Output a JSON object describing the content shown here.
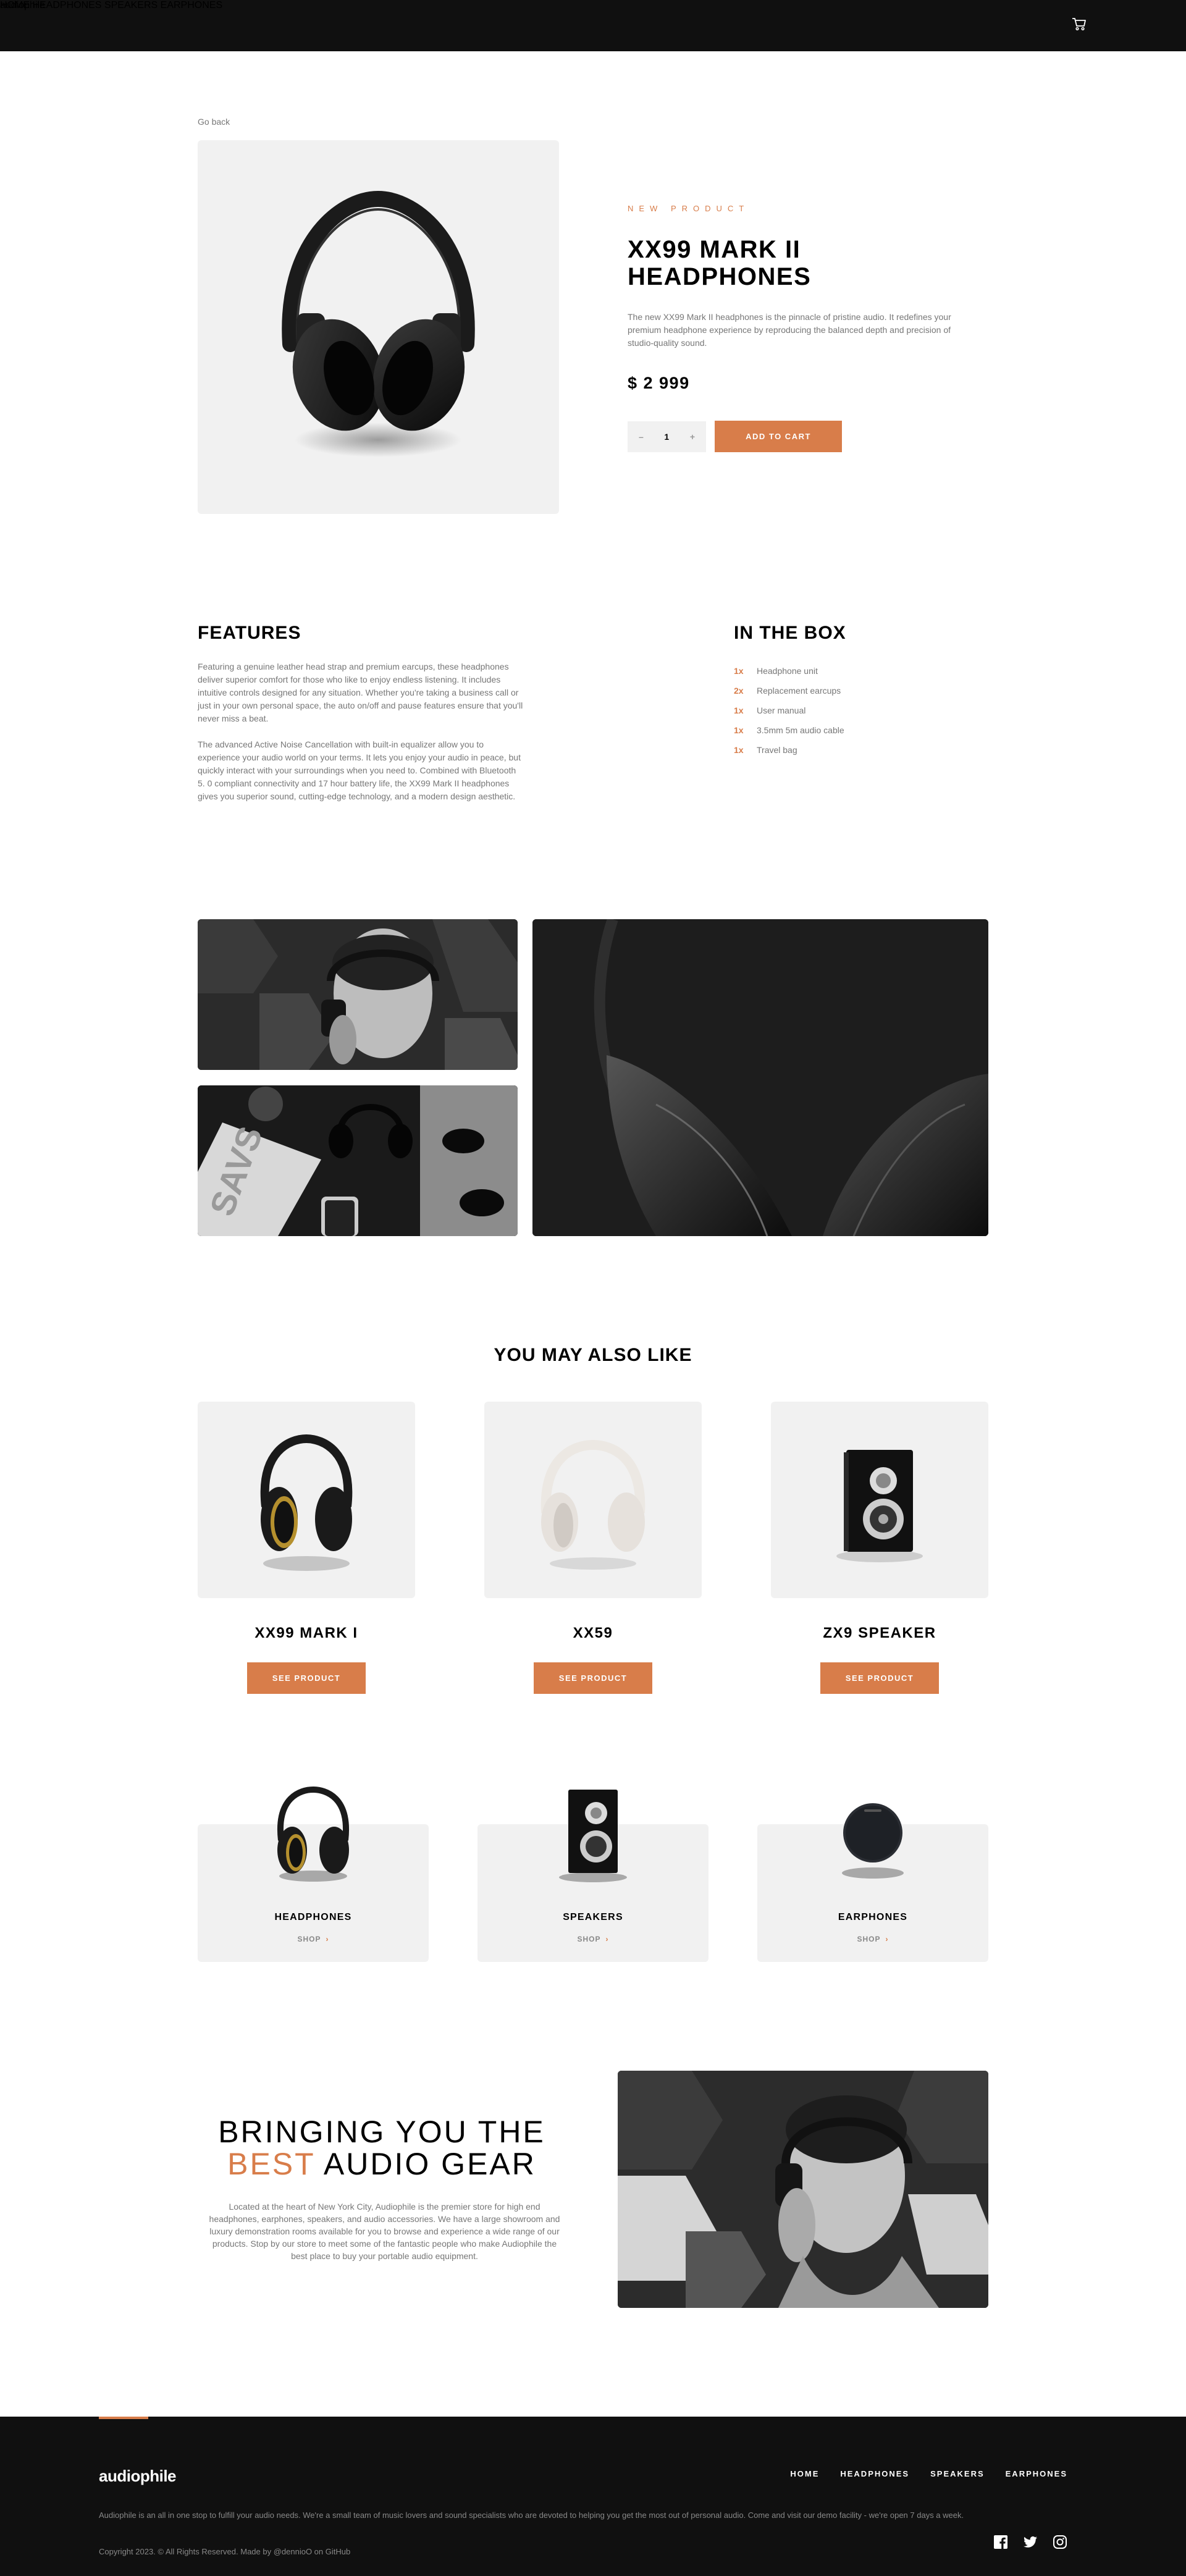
{
  "header": {
    "logo": "audiophile",
    "nav": [
      "HOME",
      "HEADPHONES",
      "SPEAKERS",
      "EARPHONES"
    ]
  },
  "product": {
    "go_back": "Go back",
    "eyebrow": "NEW PRODUCT",
    "title": "XX99 MARK II HEADPHONES",
    "description": "The new XX99 Mark II headphones is the pinnacle of pristine audio. It redefines your premium headphone experience by reproducing the balanced depth and precision of studio-quality sound.",
    "price": "$ 2 999",
    "quantity": "1",
    "minus": "–",
    "plus": "+",
    "add_to_cart": "ADD TO CART"
  },
  "features": {
    "title": "FEATURES",
    "paragraphs": [
      "Featuring a genuine leather head strap and premium earcups, these headphones deliver superior comfort for those who like to enjoy endless listening. It includes intuitive controls designed for any situation. Whether you're taking a business call or just in your own personal space, the auto on/off and pause features ensure that you'll never miss a beat.",
      "The advanced Active Noise Cancellation with built-in equalizer allow you to experience your audio world on your terms. It lets you enjoy your audio in peace, but quickly interact with your surroundings when you need to. Combined with Bluetooth 5. 0 compliant connectivity and 17 hour battery life, the XX99 Mark II headphones gives you superior sound, cutting-edge technology, and a modern design aesthetic."
    ]
  },
  "in_the_box": {
    "title": "IN THE BOX",
    "items": [
      {
        "qty": "1x",
        "name": "Headphone unit"
      },
      {
        "qty": "2x",
        "name": "Replacement earcups"
      },
      {
        "qty": "1x",
        "name": "User manual"
      },
      {
        "qty": "1x",
        "name": "3.5mm 5m audio cable"
      },
      {
        "qty": "1x",
        "name": "Travel bag"
      }
    ]
  },
  "you_may_also_like": {
    "title": "YOU MAY ALSO LIKE",
    "items": [
      {
        "name": "XX99 MARK I",
        "button": "SEE PRODUCT"
      },
      {
        "name": "XX59",
        "button": "SEE PRODUCT"
      },
      {
        "name": "ZX9 SPEAKER",
        "button": "SEE PRODUCT"
      }
    ]
  },
  "categories": [
    {
      "name": "HEADPHONES",
      "shop": "SHOP"
    },
    {
      "name": "SPEAKERS",
      "shop": "SHOP"
    },
    {
      "name": "EARPHONES",
      "shop": "SHOP"
    }
  ],
  "about": {
    "title_line1": "BRINGING YOU THE",
    "title_accent": "BEST",
    "title_line2_rest": " AUDIO GEAR",
    "text": "Located at the heart of New York City, Audiophile is the premier store for high end headphones, earphones, speakers, and audio accessories. We have a large showroom and luxury demonstration rooms available for you to browse and experience a wide range of our products. Stop by our store to meet some of the fantastic people who make Audiophile the best place to buy your portable audio equipment."
  },
  "footer": {
    "logo": "audiophile",
    "nav": [
      "HOME",
      "HEADPHONES",
      "SPEAKERS",
      "EARPHONES"
    ],
    "description": "Audiophile is an all in one stop to fulfill your audio needs. We're a small team of music lovers and sound specialists who are devoted to helping you get the most out of personal audio. Come and visit our demo facility - we're open 7 days a week.",
    "copyright": "Copyright 2023. © All Rights Reserved. Made by @dennioO on GitHub"
  },
  "colors": {
    "accent": "#D87D4A",
    "dark": "#101010",
    "light_gray": "#F1F1F1"
  },
  "icons": [
    "cart-icon",
    "facebook-icon",
    "twitter-icon",
    "instagram-icon",
    "chevron-right-icon"
  ]
}
